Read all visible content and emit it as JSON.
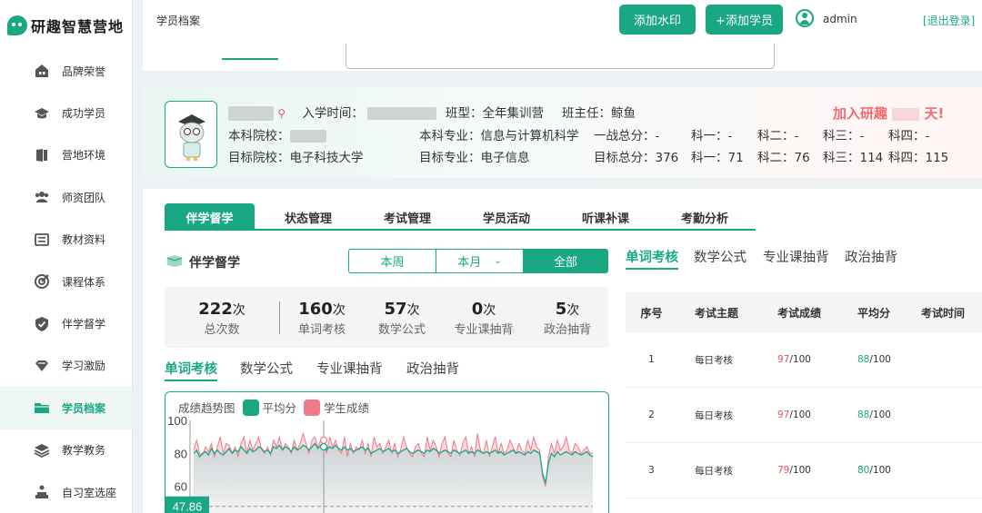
{
  "app": {
    "name": "研趣智慧营地"
  },
  "sidebar": {
    "items": [
      {
        "label": "品牌荣誉",
        "icon": "building-icon"
      },
      {
        "label": "成功学员",
        "icon": "graduation-cap-icon"
      },
      {
        "label": "营地环境",
        "icon": "door-icon"
      },
      {
        "label": "师资团队",
        "icon": "team-icon"
      },
      {
        "label": "教材资料",
        "icon": "list-icon"
      },
      {
        "label": "课程体系",
        "icon": "target-icon"
      },
      {
        "label": "伴学督学",
        "icon": "shield-check-icon"
      },
      {
        "label": "学习激励",
        "icon": "diamond-icon"
      },
      {
        "label": "学员档案",
        "icon": "folder-icon",
        "active": true
      },
      {
        "label": "教学教务",
        "icon": "layers-icon"
      },
      {
        "label": "自习室选座",
        "icon": "seat-icon"
      }
    ]
  },
  "header": {
    "title": "学员档案",
    "add_watermark": "添加水印",
    "add_student": "+添加学员",
    "user": "admin",
    "logout": "[退出登录]"
  },
  "card": {
    "enroll_label": "入学时间：",
    "class_label": "班型：全年集训营",
    "teacher_label": "班主任：鲸鱼",
    "undergrad_school_label": "本科院校：",
    "undergrad_major": "本科专业：信息与计算机科学",
    "first_total": "一战总分：-",
    "first_s1": "科一：-",
    "first_s2": "科二：-",
    "first_s3": "科三：-",
    "first_s4": "科四：-",
    "target_school": "目标院校：电子科技大学",
    "target_major": "目标专业：电子信息",
    "target_total": "目标总分：376",
    "target_s1": "科一：71",
    "target_s2": "科二：76",
    "target_s3": "科三：114",
    "target_s4": "科四：115",
    "slogan_a": "加入研趣",
    "slogan_b": "天!"
  },
  "tabs": [
    "伴学督学",
    "状态管理",
    "考试管理",
    "学员活动",
    "听课补课",
    "考勤分析"
  ],
  "section": {
    "title": "伴学督学"
  },
  "period": {
    "week": "本周",
    "month": "本月",
    "all": "全部"
  },
  "stats": [
    {
      "num": "222",
      "unit": "次",
      "label": "总次数"
    },
    {
      "num": "160",
      "unit": "次",
      "label": "单词考核"
    },
    {
      "num": "57",
      "unit": "次",
      "label": "数学公式"
    },
    {
      "num": "0",
      "unit": "次",
      "label": "专业课抽背"
    },
    {
      "num": "5",
      "unit": "次",
      "label": "政治抽背"
    }
  ],
  "subtabs": [
    "单词考核",
    "数学公式",
    "专业课抽背",
    "政治抽背"
  ],
  "chart_data": {
    "type": "line",
    "title": "成绩趋势图",
    "ylim": [
      40,
      100
    ],
    "yticks": [
      "100",
      "80",
      "60"
    ],
    "marker_value": "47.86",
    "series": [
      {
        "name": "平均分",
        "color": "#1aa784",
        "values": [
          80,
          82,
          78,
          80,
          81,
          79,
          83,
          80,
          82,
          80,
          79,
          81,
          83,
          80,
          82,
          81,
          84,
          82,
          80,
          83,
          81,
          82,
          84,
          83,
          81,
          82,
          80,
          84,
          83,
          85,
          82,
          84,
          83,
          81,
          84,
          82,
          83,
          85,
          84,
          82,
          84,
          86,
          83,
          85,
          84,
          82,
          84,
          83,
          85,
          83,
          82,
          84,
          82,
          83,
          81,
          82,
          83,
          84,
          82,
          83,
          80,
          81,
          82,
          83,
          81,
          82,
          83,
          81,
          82,
          80,
          81,
          82,
          83,
          81,
          80,
          81,
          82,
          81,
          80,
          82,
          81,
          83,
          82,
          80,
          81,
          82,
          81,
          80,
          82,
          81,
          80,
          81,
          82,
          80,
          81,
          80,
          82,
          81,
          80,
          81,
          80,
          81,
          82,
          80,
          81,
          79,
          80,
          81,
          82,
          80,
          81,
          80,
          79,
          81,
          80,
          82,
          81,
          80,
          68,
          62,
          74,
          80,
          78,
          81,
          79,
          80,
          81,
          80,
          79,
          81,
          80,
          79,
          80,
          81,
          79,
          78
        ]
      },
      {
        "name": "学生成绩",
        "color": "#f07a8a",
        "values": [
          82,
          88,
          80,
          79,
          84,
          81,
          86,
          78,
          84,
          90,
          80,
          86,
          85,
          80,
          84,
          78,
          86,
          90,
          80,
          88,
          82,
          86,
          90,
          82,
          80,
          84,
          79,
          88,
          84,
          90,
          82,
          86,
          84,
          80,
          88,
          82,
          86,
          92,
          86,
          80,
          88,
          90,
          84,
          88,
          86,
          80,
          90,
          84,
          88,
          82,
          80,
          90,
          78,
          86,
          80,
          84,
          82,
          88,
          80,
          86,
          78,
          90,
          84,
          86,
          80,
          84,
          88,
          80,
          86,
          78,
          82,
          90,
          84,
          80,
          78,
          84,
          86,
          80,
          78,
          90,
          82,
          88,
          84,
          78,
          86,
          90,
          80,
          78,
          88,
          82,
          79,
          86,
          90,
          80,
          84,
          78,
          92,
          82,
          80,
          88,
          78,
          84,
          90,
          80,
          86,
          80,
          82,
          88,
          84,
          80,
          86,
          82,
          80,
          88,
          82,
          90,
          84,
          82,
          66,
          60,
          78,
          86,
          80,
          88,
          82,
          84,
          90,
          82,
          80,
          86,
          84,
          80,
          82,
          84,
          80,
          80
        ]
      }
    ]
  },
  "right": {
    "subtabs": [
      "单词考核",
      "数学公式",
      "专业课抽背",
      "政治抽背"
    ],
    "table": {
      "headers": [
        "序号",
        "考试主题",
        "考试成绩",
        "平均分",
        "考试时间"
      ],
      "rows": [
        {
          "idx": "1",
          "topic": "每日考核",
          "score": "97",
          "score_total": "/100",
          "avg": "88",
          "avg_total": "/100"
        },
        {
          "idx": "2",
          "topic": "每日考核",
          "score": "97",
          "score_total": "/100",
          "avg": "88",
          "avg_total": "/100"
        },
        {
          "idx": "3",
          "topic": "每日考核",
          "score": "79",
          "score_total": "/100",
          "avg": "80",
          "avg_total": "/100"
        }
      ]
    }
  }
}
